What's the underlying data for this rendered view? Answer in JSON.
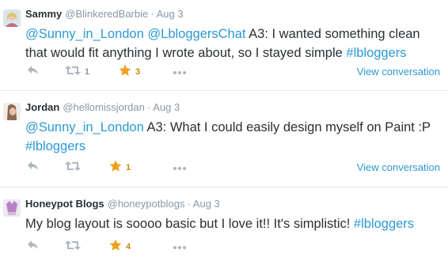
{
  "tweets": [
    {
      "name": "Sammy",
      "handle": "@BlinkeredBarbie",
      "time": "Aug 3",
      "text_parts": [
        "@Sunny_in_London",
        " ",
        "@LbloggersChat",
        " A3: I wanted something clean that would fit anything I wrote about, so I stayed simple ",
        "#lbloggers"
      ],
      "retweets": "1",
      "favorites": "3",
      "view_link": "View conversation"
    },
    {
      "name": "Jordan",
      "handle": "@hellomissjordan",
      "time": "Aug 3",
      "text_parts": [
        "@Sunny_in_London",
        " A3: What I could easily design myself on Paint :P ",
        "#lbloggers"
      ],
      "retweets": "",
      "favorites": "1",
      "view_link": "View conversation"
    },
    {
      "name": "Honeypot Blogs",
      "handle": "@honeypotblogs",
      "time": "Aug 3",
      "text_parts": [
        "My blog layout is soooo basic but I love it!! It's simplistic! ",
        "#lbloggers"
      ],
      "retweets": "",
      "favorites": "4",
      "view_link": ""
    }
  ],
  "colors": {
    "link": "#2b9ad5",
    "meta": "#8899a6",
    "star": "#f0a020",
    "text": "#292f33"
  },
  "icons": [
    "reply-icon",
    "retweet-icon",
    "star-icon",
    "more-icon"
  ]
}
